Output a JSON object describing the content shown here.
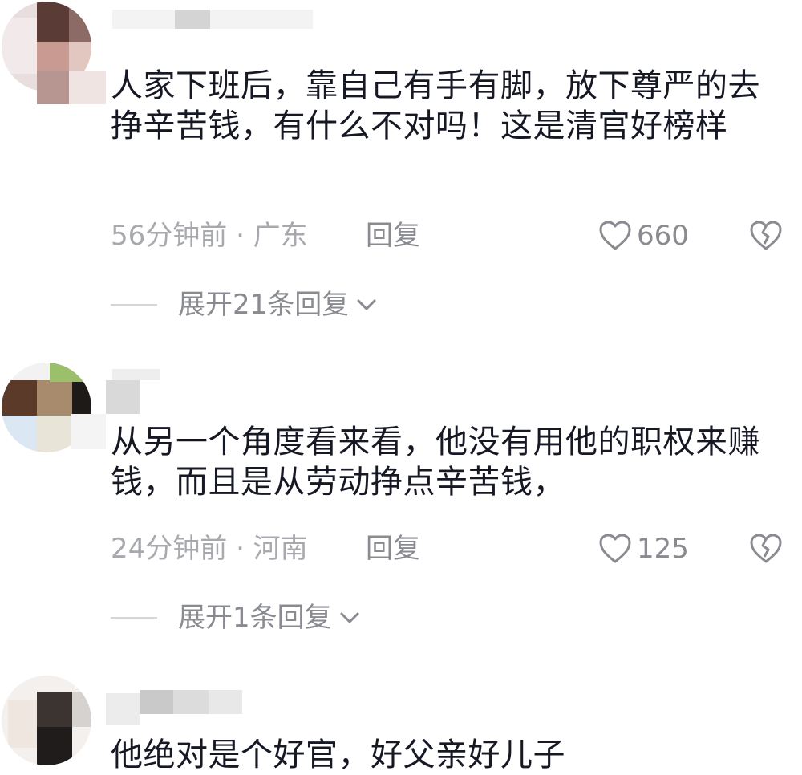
{
  "comments": [
    {
      "text": "人家下班后，靠自己有手有脚，放下尊严的去挣辛苦钱，有什么不对吗！这是清官好榜样",
      "time_location": "56分钟前 · 广东",
      "reply_label": "回复",
      "likes": "660",
      "expand_label": "展开21条回复"
    },
    {
      "text": "从另一个角度看来看，他没有用他的职权来赚钱，而且是从劳动挣点辛苦钱，",
      "time_location": "24分钟前 · 河南",
      "reply_label": "回复",
      "likes": "125",
      "expand_label": "展开1条回复"
    },
    {
      "text": "他绝对是个好官，好父亲好儿子"
    }
  ],
  "icons": {
    "like": "heart-outline-icon",
    "dislike": "broken-heart-icon",
    "expand": "chevron-down-icon"
  },
  "colors": {
    "text": "#161823",
    "meta": "#a7a9ae",
    "action": "#8a8b91",
    "divider": "#d5d6d8"
  }
}
